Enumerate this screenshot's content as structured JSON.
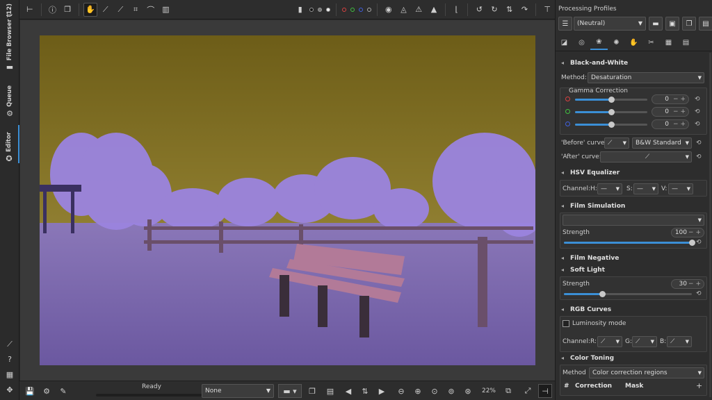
{
  "left_tabs": [
    {
      "label": "File Browser (12)",
      "icon": "folder-icon"
    },
    {
      "label": "Queue",
      "icon": "gears-icon"
    },
    {
      "label": "Editor",
      "icon": "aperture-icon"
    }
  ],
  "bottom_status": {
    "label": "Ready"
  },
  "bottom_select": {
    "value": "None"
  },
  "zoom": {
    "value": "22%"
  },
  "profiles": {
    "title": "Processing Profiles",
    "selected": "(Neutral)"
  },
  "bw": {
    "title": "Black-and-White",
    "method_label": "Method:",
    "method_value": "Desaturation",
    "gamma_title": "Gamma Correction",
    "gamma": [
      {
        "color": "#d94040",
        "value": "0",
        "level": 0.5
      },
      {
        "color": "#40c040",
        "value": "0",
        "level": 0.5
      },
      {
        "color": "#4060e0",
        "value": "0",
        "level": 0.5
      }
    ],
    "before_label": "'Before' curve:",
    "before_value": "B&W Standard",
    "after_label": "'After' curve:"
  },
  "hsv": {
    "title": "HSV Equalizer",
    "channel_label": "Channel:",
    "h": "H:",
    "s": "S:",
    "v": "V:"
  },
  "film_sim": {
    "title": "Film Simulation",
    "strength_label": "Strength",
    "strength_value": "100",
    "level": 1.0
  },
  "film_neg": {
    "title": "Film Negative"
  },
  "soft_light": {
    "title": "Soft Light",
    "strength_label": "Strength",
    "strength_value": "30",
    "level": 0.3
  },
  "rgb_curves": {
    "title": "RGB Curves",
    "luminosity_label": "Luminosity mode",
    "channel_label": "Channel:",
    "r": "R:",
    "g": "G:",
    "b": "B:"
  },
  "color_toning": {
    "title": "Color Toning",
    "method_label": "Method",
    "method_value": "Color correction regions",
    "col_hash": "#",
    "col_correction": "Correction",
    "col_mask": "Mask"
  }
}
